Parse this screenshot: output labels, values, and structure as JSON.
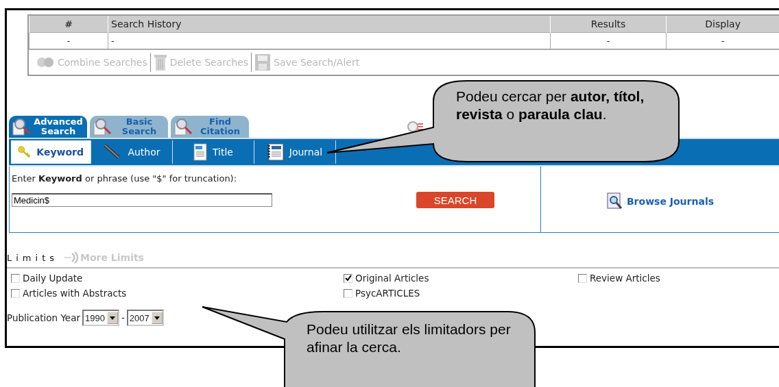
{
  "history": {
    "columns": [
      "#",
      "Search History",
      "Results",
      "Display"
    ],
    "rows": [
      [
        "-",
        "-",
        "-",
        "-"
      ]
    ],
    "actions": [
      {
        "label": "Combine Searches",
        "kind": "combine",
        "disabled": true
      },
      {
        "label": "Delete Searches",
        "kind": "delete",
        "disabled": true
      },
      {
        "label": "Save Search/Alert",
        "kind": "save",
        "disabled": true
      }
    ]
  },
  "search_tabs": [
    {
      "label": "Advanced Search",
      "selected": true
    },
    {
      "label": "Basic Search",
      "selected": false
    },
    {
      "label": "Find Citation",
      "selected": false
    }
  ],
  "field_tabs": [
    {
      "label": "Keyword",
      "kind": "key",
      "selected": true
    },
    {
      "label": "Author",
      "kind": "pen",
      "selected": false
    },
    {
      "label": "Title",
      "kind": "doc",
      "selected": false
    },
    {
      "label": "Journal",
      "kind": "journal",
      "selected": false
    }
  ],
  "prompt": "Enter **Keyword** or phrase (use \"$\" for truncation):",
  "keyword": {
    "value": "Medicin$"
  },
  "search_button": "SEARCH",
  "browse_link": "Browse Journals",
  "limits": {
    "title": "Limits",
    "more": {
      "label": "More Limits",
      "disabled": true
    },
    "options": [
      {
        "label": "Daily Update",
        "checked": false
      },
      {
        "label": "Original Articles",
        "checked": true
      },
      {
        "label": "Review Articles",
        "checked": false
      },
      {
        "label": "Articles with Abstracts",
        "checked": false
      },
      {
        "label": "PsycARTICLES",
        "checked": false
      }
    ],
    "year": {
      "label": "Publication Year",
      "from": "1990",
      "separator": "-",
      "to": "2007"
    }
  },
  "callouts": [
    {
      "text": "Podeu cercar per **autor, títol, revista** o **paraula clau**."
    },
    {
      "text": "Podeu utilitzar els limitadors per afinar la cerca."
    }
  ]
}
